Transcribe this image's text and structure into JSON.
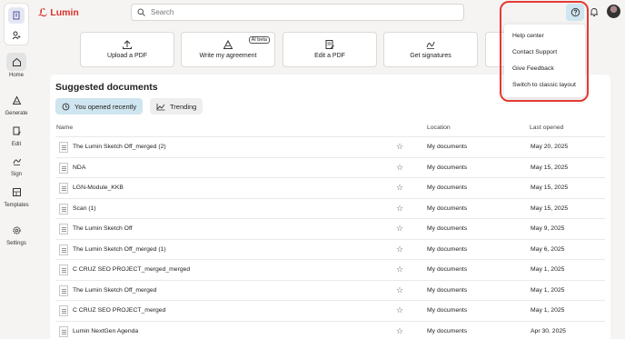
{
  "brand": {
    "name": "Lumin"
  },
  "search": {
    "placeholder": "Search"
  },
  "nav": {
    "items": [
      {
        "label": "Home"
      },
      {
        "label": "Generate"
      },
      {
        "label": "Edit"
      },
      {
        "label": "Sign"
      },
      {
        "label": "Templates"
      },
      {
        "label": "Settings"
      }
    ]
  },
  "actions": [
    {
      "label": "Upload a PDF"
    },
    {
      "label": "Write my agreement",
      "badge": "AI beta"
    },
    {
      "label": "Edit a PDF"
    },
    {
      "label": "Get signatures"
    }
  ],
  "suggested": {
    "title": "Suggested documents",
    "filters": [
      {
        "label": "You opened recently"
      },
      {
        "label": "Trending"
      }
    ],
    "columns": {
      "name": "Name",
      "location": "Location",
      "last_opened": "Last opened"
    },
    "rows": [
      {
        "name": "The Lumin Sketch Off_merged (2)",
        "location": "My documents",
        "date": "May 20, 2025"
      },
      {
        "name": "NDA",
        "location": "My documents",
        "date": "May 15, 2025"
      },
      {
        "name": "LGN-Module_KKB",
        "location": "My documents",
        "date": "May 15, 2025"
      },
      {
        "name": "Scan (1)",
        "location": "My documents",
        "date": "May 15, 2025"
      },
      {
        "name": "The Lumin Sketch Off",
        "location": "My documents",
        "date": "May 9, 2025"
      },
      {
        "name": "The Lumin Sketch Off_merged (1)",
        "location": "My documents",
        "date": "May 6, 2025"
      },
      {
        "name": "C CRUZ SEO PROJECT_merged_merged",
        "location": "My documents",
        "date": "May 1, 2025"
      },
      {
        "name": "The Lumin Sketch Off_merged",
        "location": "My documents",
        "date": "May 1, 2025"
      },
      {
        "name": "C CRUZ SEO PROJECT_merged",
        "location": "My documents",
        "date": "May 1, 2025"
      },
      {
        "name": "Lumin NextGen Agenda",
        "location": "My documents",
        "date": "Apr 30, 2025"
      }
    ]
  },
  "help_menu": {
    "items": [
      {
        "label": "Help center"
      },
      {
        "label": "Contact Support"
      },
      {
        "label": "Give Feedback"
      },
      {
        "label": "Switch to classic layout"
      }
    ]
  },
  "colors": {
    "brand": "#d9312b",
    "highlight": "#e53935",
    "active_chip": "#cfe5ef"
  }
}
